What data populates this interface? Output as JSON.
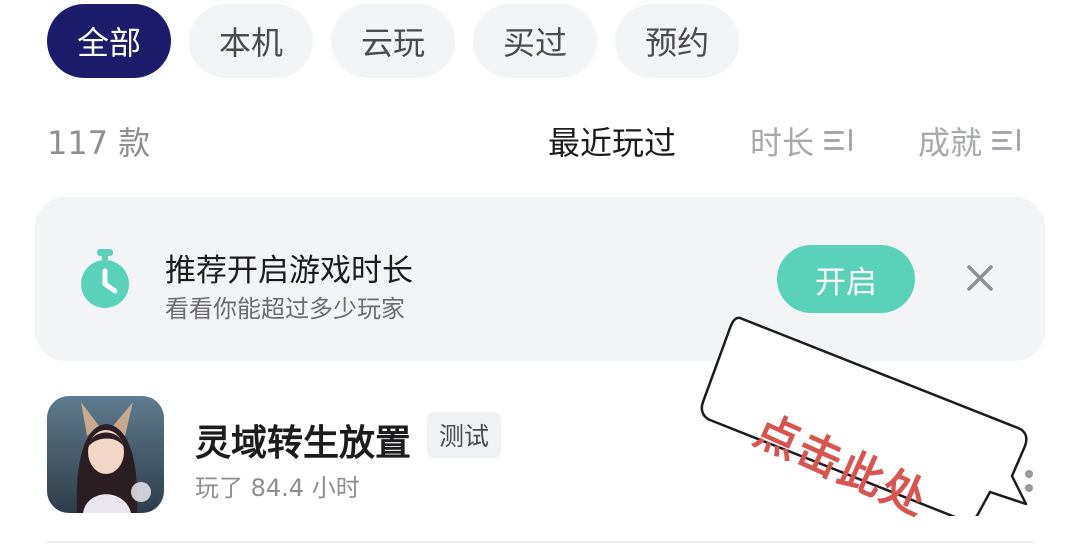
{
  "tabs": [
    {
      "label": "全部",
      "active": true
    },
    {
      "label": "本机",
      "active": false
    },
    {
      "label": "云玩",
      "active": false
    },
    {
      "label": "买过",
      "active": false
    },
    {
      "label": "预约",
      "active": false
    }
  ],
  "summary": {
    "count_text": "117 款"
  },
  "sort": {
    "recent": "最近玩过",
    "duration": "时长",
    "achievement": "成就"
  },
  "banner": {
    "title": "推荐开启游戏时长",
    "subtitle": "看看你能超过多少玩家",
    "button_label": "开启",
    "icon": "stopwatch-icon",
    "accent_color": "#5ad2b9"
  },
  "game": {
    "name": "灵域转生放置",
    "tag": "测试",
    "play_time": "玩了 84.4 小时"
  },
  "annotation": {
    "text": "点击此处",
    "color": "#d9534f"
  },
  "colors": {
    "active_tab": "#1d1c6b",
    "tab_bg": "#f3f4f6"
  }
}
